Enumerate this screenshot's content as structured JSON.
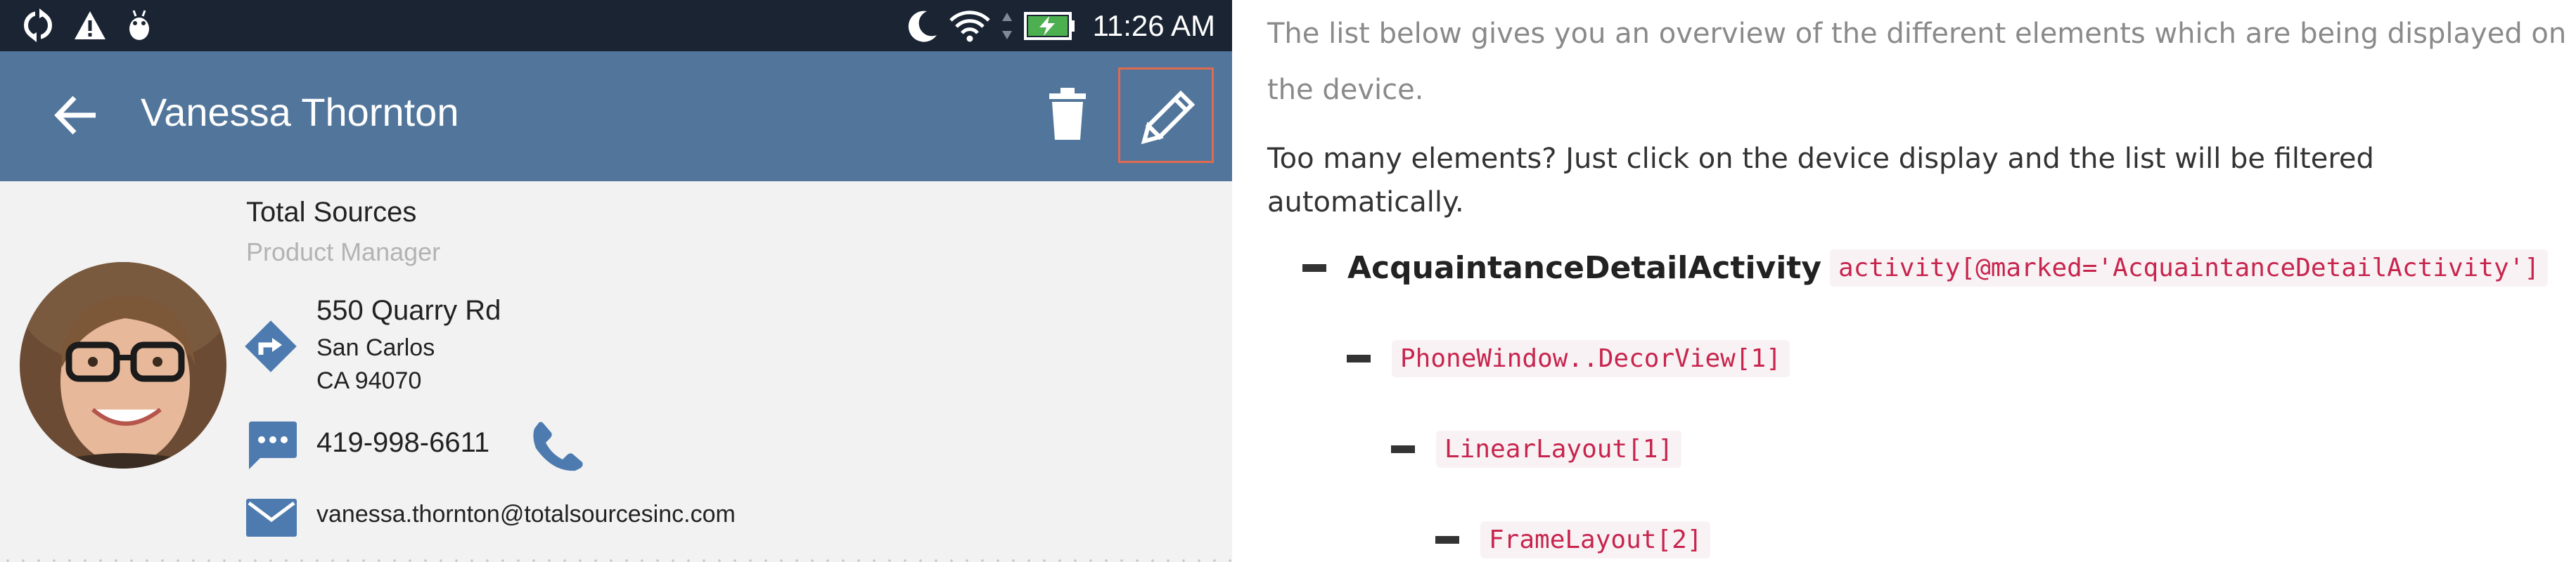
{
  "device": {
    "status_bar": {
      "time": "11:26 AM",
      "left_icons": [
        "sync-icon",
        "warning-icon",
        "android-debug-icon"
      ],
      "right_icons": [
        "do-not-disturb-moon-icon",
        "wifi-icon",
        "battery-charging-icon"
      ]
    },
    "app_bar": {
      "title": "Vanessa Thornton",
      "color": "#52769b",
      "actions": [
        "back-arrow-icon",
        "delete-icon",
        "edit-icon"
      ]
    },
    "contact": {
      "company": "Total Sources",
      "job_title": "Product Manager",
      "street": "550 Quarry Rd",
      "city": "San Carlos",
      "state_zip": "CA 94070",
      "phone": "419-998-6611",
      "email": "vanessa.thornton@totalsourcesinc.com"
    },
    "highlight_color": "#e06a4e"
  },
  "panel": {
    "intro": "The list below gives you an overview of the different elements which are being displayed on the device.",
    "intro2": "Too many elements? Just click on the device display and the list will be filtered automatically.",
    "tree": [
      {
        "name": "AcquaintanceDetailActivity",
        "selector": "activity[@marked='AcquaintanceDetailActivity']"
      },
      {
        "name": "",
        "selector": "PhoneWindow..DecorView[1]"
      },
      {
        "name": "",
        "selector": "LinearLayout[1]"
      },
      {
        "name": "",
        "selector": "FrameLayout[2]"
      }
    ]
  }
}
